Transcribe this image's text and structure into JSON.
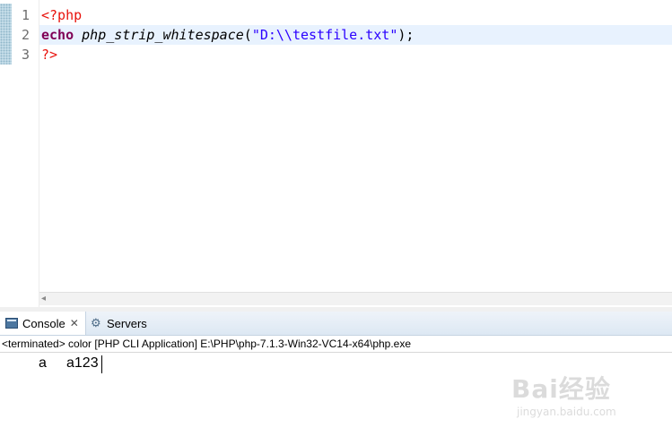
{
  "editor": {
    "line_numbers": [
      "1",
      "2",
      "3"
    ],
    "lines": {
      "l1": {
        "open_tag": "<?php"
      },
      "l2": {
        "keyword": "echo",
        "function": "php_strip_whitespace",
        "open_paren": "(",
        "string": "\"D:\\\\testfile.txt\"",
        "close": ");"
      },
      "l3": {
        "close_tag": "?>"
      }
    },
    "colors": {
      "tag": "#e8120c",
      "keyword": "#7f0055",
      "string": "#2a00ff",
      "current_line": "#e8f2fe"
    }
  },
  "console": {
    "tabs": [
      {
        "label": "Console",
        "close": "✕",
        "icon": "console-icon",
        "active": true
      },
      {
        "label": "Servers",
        "icon": "servers-icon",
        "active": false
      }
    ],
    "status": "<terminated> color [PHP CLI Application] E:\\PHP\\php-7.1.3-Win32-VC14-x64\\php.exe",
    "output": {
      "first": "a",
      "second": "a123"
    }
  },
  "watermark": {
    "logo": "Bai经验",
    "sub": "jingyan.baidu.com"
  }
}
